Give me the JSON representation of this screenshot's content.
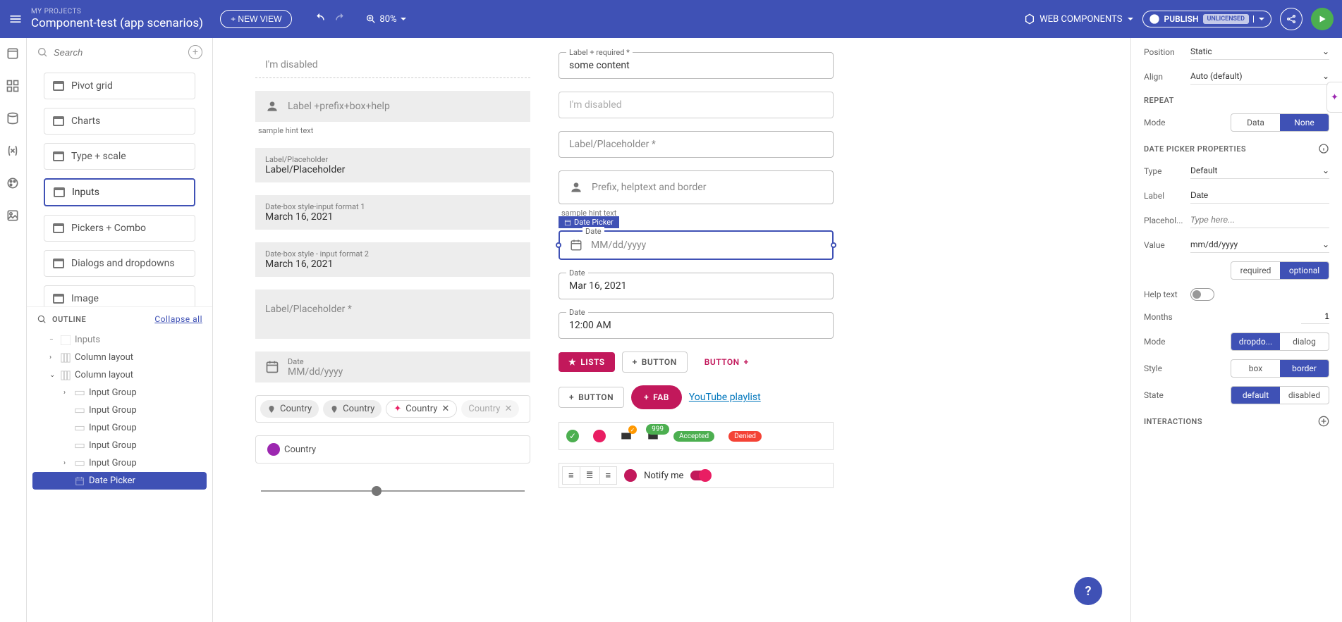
{
  "header": {
    "projects_label": "MY PROJECTS",
    "project_name": "Component-test (app scenarios)",
    "new_view": "+ NEW VIEW",
    "zoom": "80%",
    "web_components": "WEB COMPONENTS",
    "publish": "PUBLISH",
    "publish_badge": "UNLICENSED"
  },
  "search": {
    "placeholder": "Search"
  },
  "views": [
    {
      "label": "Pivot grid",
      "selected": false
    },
    {
      "label": "Charts",
      "selected": false
    },
    {
      "label": "Type + scale",
      "selected": false
    },
    {
      "label": "Inputs",
      "selected": true
    },
    {
      "label": "Pickers + Combo",
      "selected": false
    },
    {
      "label": "Dialogs and dropdowns",
      "selected": false
    },
    {
      "label": "Image",
      "selected": false
    }
  ],
  "outline": {
    "title": "OUTLINE",
    "collapse": "Collapse all",
    "nodes": [
      {
        "label": "Inputs",
        "indent": 1,
        "chev": ""
      },
      {
        "label": "Column layout",
        "indent": 1,
        "chev": "›"
      },
      {
        "label": "Column layout",
        "indent": 1,
        "chev": "⌄"
      },
      {
        "label": "Input Group",
        "indent": 2,
        "chev": "›"
      },
      {
        "label": "Input Group",
        "indent": 2,
        "chev": ""
      },
      {
        "label": "Input Group",
        "indent": 2,
        "chev": ""
      },
      {
        "label": "Input Group",
        "indent": 2,
        "chev": ""
      },
      {
        "label": "Input Group",
        "indent": 2,
        "chev": "›"
      },
      {
        "label": "Date Picker",
        "indent": 2,
        "chev": "",
        "selected": true
      }
    ]
  },
  "canvas": {
    "left": {
      "disabled_placeholder": "I'm disabled",
      "prefix_label": "Label +prefix+box+help",
      "hint1": "sample hint text",
      "lp_label": "Label/Placeholder",
      "lp_value": "Label/Placeholder",
      "datebox1_label": "Date-box style-input format 1",
      "datebox1_value": "March 16, 2021",
      "datebox2_label": "Date-box style - input format 2",
      "datebox2_value": "March 16, 2021",
      "textarea_label": "Label/Placeholder *",
      "date_simple_label": "Date",
      "date_simple_value": "MM/dd/yyyy",
      "chip": "Country",
      "chip_avatar": "Country"
    },
    "right": {
      "label_required": "Label + required *",
      "content_value": "some content",
      "disabled_placeholder": "I'm disabled",
      "lp_star": "Label/Placeholder *",
      "prefix_help": "Prefix, helptext and border",
      "hint2": "sample hint text",
      "sel_tag": "Date Picker",
      "sel_date_label": "Date",
      "sel_date_value": "MM/dd/yyyy",
      "date2_label": "Date",
      "date2_value": "Mar 16, 2021",
      "time_label": "Date",
      "time_value": "12:00 AM",
      "btn_lists": "LISTS",
      "btn_button": "BUTTON",
      "btn_button2": "BUTTON",
      "btn_button3": "BUTTON",
      "btn_fab": "FAB",
      "yt_link": "YouTube playlist",
      "badge_999": "999",
      "badge_accepted": "Accepted",
      "badge_denied": "Denied",
      "notify": "Notify me"
    }
  },
  "right_panel": {
    "position_label": "Position",
    "position_value": "Static",
    "align_label": "Align",
    "align_value": "Auto (default)",
    "repeat_title": "REPEAT",
    "mode_label": "Mode",
    "mode_data": "Data",
    "mode_none": "None",
    "props_title": "DATE PICKER PROPERTIES",
    "type_label": "Type",
    "type_value": "Default",
    "label_label": "Label",
    "label_value": "Date",
    "placeholder_label": "Placehol...",
    "placeholder_value": "Type here...",
    "value_label": "Value",
    "value_value": "mm/dd/yyyy",
    "required": "required",
    "optional": "optional",
    "helptext_label": "Help text",
    "months_label": "Months",
    "months_value": "1",
    "mode2_label": "Mode",
    "mode2_dropdown": "dropdo...",
    "mode2_dialog": "dialog",
    "style_label": "Style",
    "style_box": "box",
    "style_border": "border",
    "state_label": "State",
    "state_default": "default",
    "state_disabled": "disabled",
    "interactions_title": "INTERACTIONS"
  }
}
